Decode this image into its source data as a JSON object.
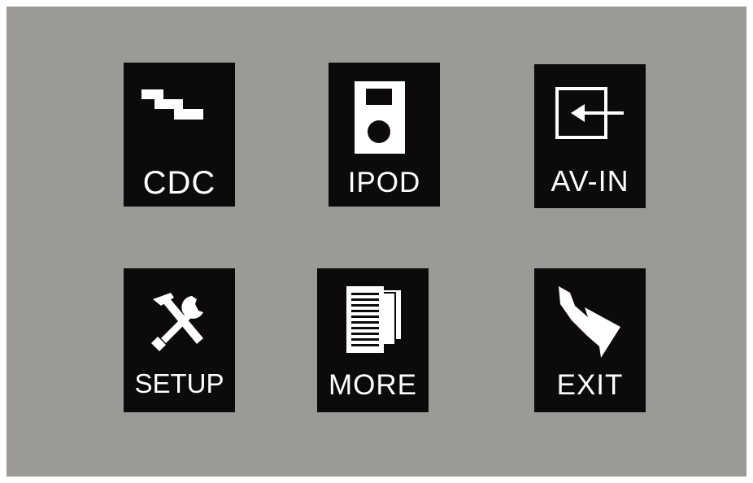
{
  "menu": {
    "items": [
      {
        "label": "CDC",
        "icon": "cd-changer-icon"
      },
      {
        "label": "IPOD",
        "icon": "ipod-icon"
      },
      {
        "label": "AV-IN",
        "icon": "av-input-icon"
      },
      {
        "label": "SETUP",
        "icon": "tools-icon"
      },
      {
        "label": "MORE",
        "icon": "documents-icon"
      },
      {
        "label": "EXIT",
        "icon": "exit-arrow-icon"
      }
    ]
  },
  "colors": {
    "background": "#9b9a97",
    "tile": "#0c0a0a",
    "foreground": "#ffffff"
  }
}
